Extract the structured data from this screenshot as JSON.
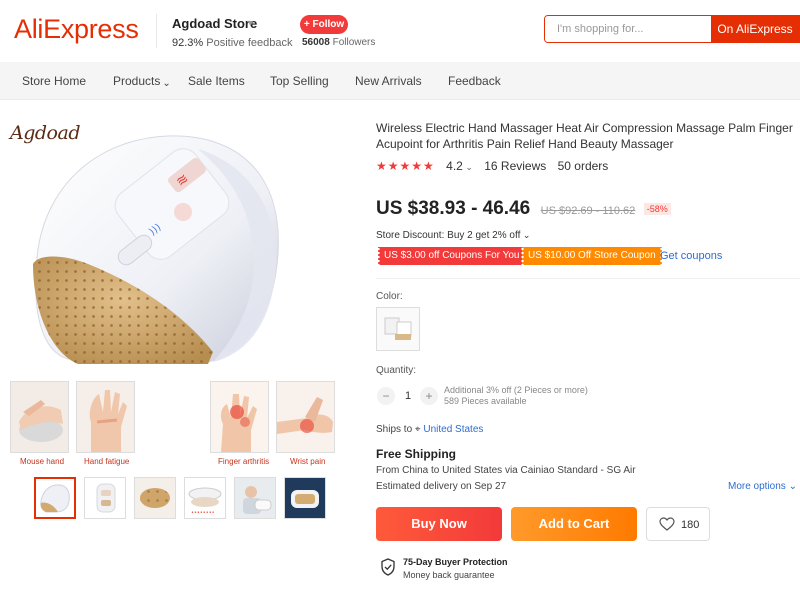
{
  "header": {
    "logo": "AliExpress",
    "store_name": "Agdoad Store",
    "feedback_pct": "92.3%",
    "feedback_label": "Positive feedback",
    "follow_label": "+ Follow",
    "followers_count": "56008",
    "followers_label": "Followers",
    "search_placeholder": "I'm shopping for...",
    "search_button": "On AliExpress"
  },
  "nav": {
    "items": [
      "Store Home",
      "Products",
      "Sale Items",
      "Top Selling",
      "New Arrivals",
      "Feedback"
    ]
  },
  "gallery": {
    "brand": "Agdoad",
    "feature_labels": [
      "Mouse hand",
      "Hand fatigue",
      "Finger arthritis",
      "Wrist pain"
    ],
    "thumbnail_count": 6
  },
  "product": {
    "title": "Wireless Electric Hand Massager Heat Air Compression Massage Palm Finger Acupoint for Arthritis Pain Relief Hand Beauty Massager",
    "rating": "4.2",
    "stars": "★★★★★",
    "reviews": "16 Reviews",
    "orders": "50 orders",
    "price": "US $38.93 - 46.46",
    "original_price": "US $92.69 - 110.62",
    "discount": "-58%",
    "store_discount": "Store Discount: Buy 2 get 2% off",
    "coupon_1": "US $3.00 off Coupons For You",
    "coupon_2": "US $10.00 Off Store Coupon",
    "get_coupons": "Get coupons",
    "color_label": "Color:",
    "quantity_label": "Quantity:",
    "quantity_value": "1",
    "qty_note_1": "Additional 3% off (2 Pieces or more)",
    "qty_note_2": "589 Pieces available",
    "ships_to_label": "Ships to",
    "ships_to_location": "United States",
    "free_shipping": "Free Shipping",
    "shipping_route": "From China to United States via Cainiao Standard - SG Air",
    "delivery": "Estimated delivery on Sep 27",
    "more_options": "More options",
    "buy_now": "Buy Now",
    "add_to_cart": "Add to Cart",
    "wishlist_count": "180",
    "protection_title": "75-Day Buyer Protection",
    "protection_sub": "Money back guarantee"
  },
  "colors": {
    "brand_red": "#e62e04",
    "button_red": "#f23a3a",
    "button_orange": "#ff8a00",
    "link_blue": "#2e6cd0"
  }
}
